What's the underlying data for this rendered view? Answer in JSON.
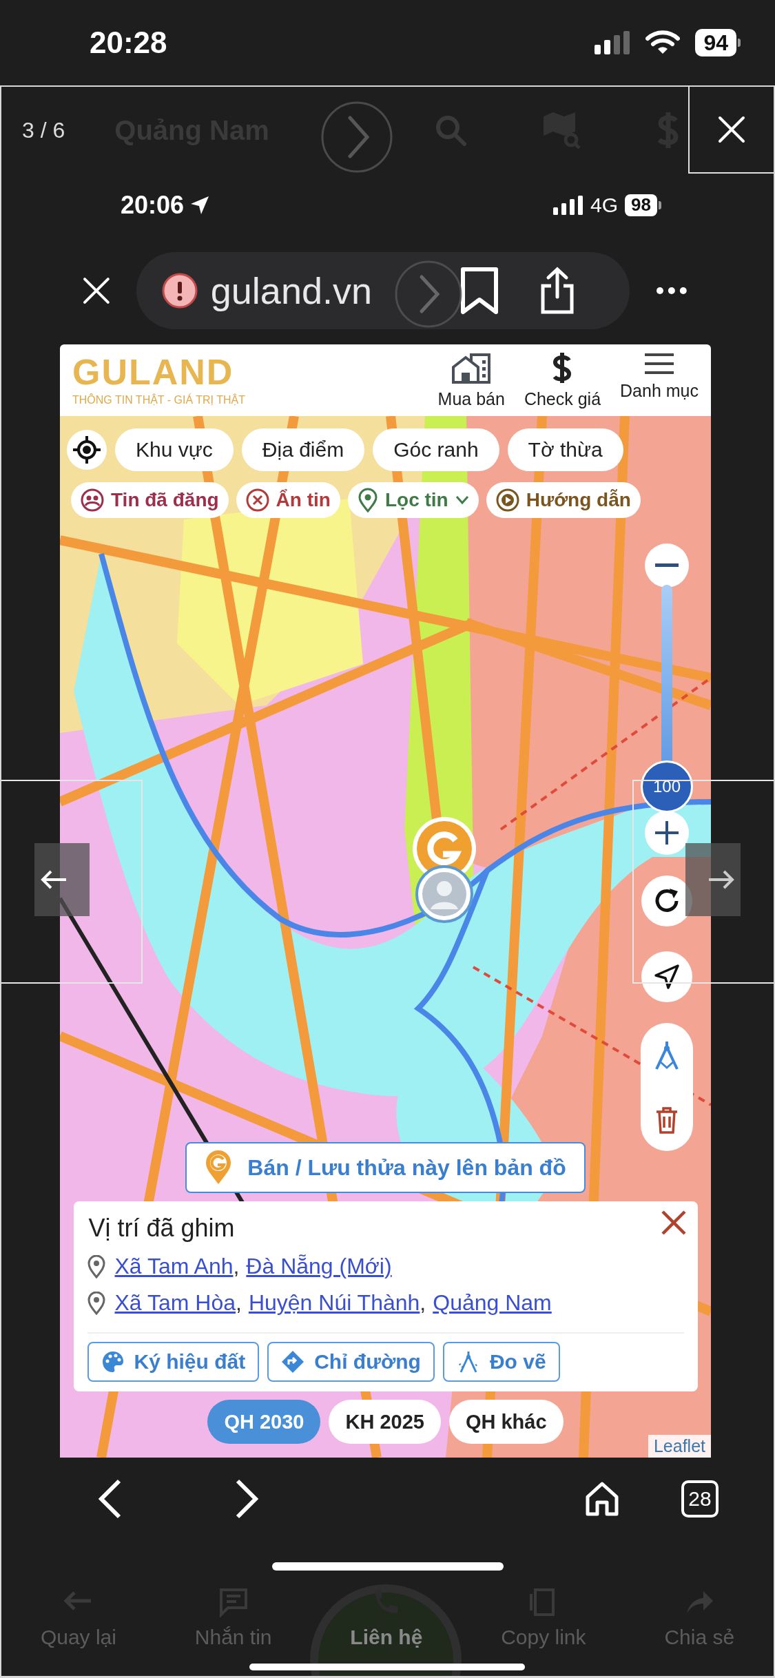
{
  "status_bar": {
    "time": "20:28",
    "battery": "94"
  },
  "viewer": {
    "counter": "3 / 6",
    "faded_location": "Quảng Nam"
  },
  "inner_status": {
    "time": "20:06",
    "network": "4G",
    "battery": "98"
  },
  "browser": {
    "url": "guland.vn",
    "tab_count": "28"
  },
  "site_header": {
    "logo": "GULAND",
    "tagline": "THÔNG TIN THẬT - GIÁ TRỊ THẬT",
    "nav": [
      {
        "label": "Mua bán"
      },
      {
        "label": "Check giá"
      },
      {
        "label": "Danh mục"
      }
    ]
  },
  "search_modes": [
    {
      "label": "Khu vực"
    },
    {
      "label": "Địa điểm"
    },
    {
      "label": "Góc ranh"
    },
    {
      "label": "Tờ thừa"
    }
  ],
  "filters": [
    {
      "label": "Tin đã đăng",
      "color": "#9c2f4c",
      "kind": "toggle"
    },
    {
      "label": "Ẩn tin",
      "color": "#b33a3a",
      "kind": "toggle"
    },
    {
      "label": "Lọc tin",
      "color": "#3f7a47",
      "kind": "dropdown"
    },
    {
      "label": "Hướng dẫn",
      "color": "#7a5520",
      "kind": "toggle"
    }
  ],
  "zoom": {
    "level": 1,
    "reading": "100"
  },
  "pin_button": {
    "label": "Bán / Lưu thửa này lên bản đồ"
  },
  "popup": {
    "title": "Vị trí đã ghim",
    "separator": ",",
    "addresses": [
      {
        "links": [
          "Xã Tam Anh",
          "Đà Nẵng (Mới)"
        ]
      },
      {
        "links": [
          "Xã Tam Hòa",
          "Huyện Núi Thành",
          "Quảng Nam"
        ]
      }
    ],
    "actions": [
      {
        "label": "Ký hiệu đất"
      },
      {
        "label": "Chỉ đường"
      },
      {
        "label": "Đo vẽ"
      }
    ]
  },
  "layers": [
    {
      "label": "QH 2030",
      "selected": true
    },
    {
      "label": "KH 2025",
      "selected": false
    },
    {
      "label": "QH khác",
      "selected": false
    }
  ],
  "attribution": "Leaflet",
  "faded_bottom_bar": [
    {
      "label": "Quay lại"
    },
    {
      "label": "Nhắn tin"
    },
    {
      "label": "Liên hệ"
    },
    {
      "label": "Copy link"
    },
    {
      "label": "Chia sẻ"
    }
  ]
}
